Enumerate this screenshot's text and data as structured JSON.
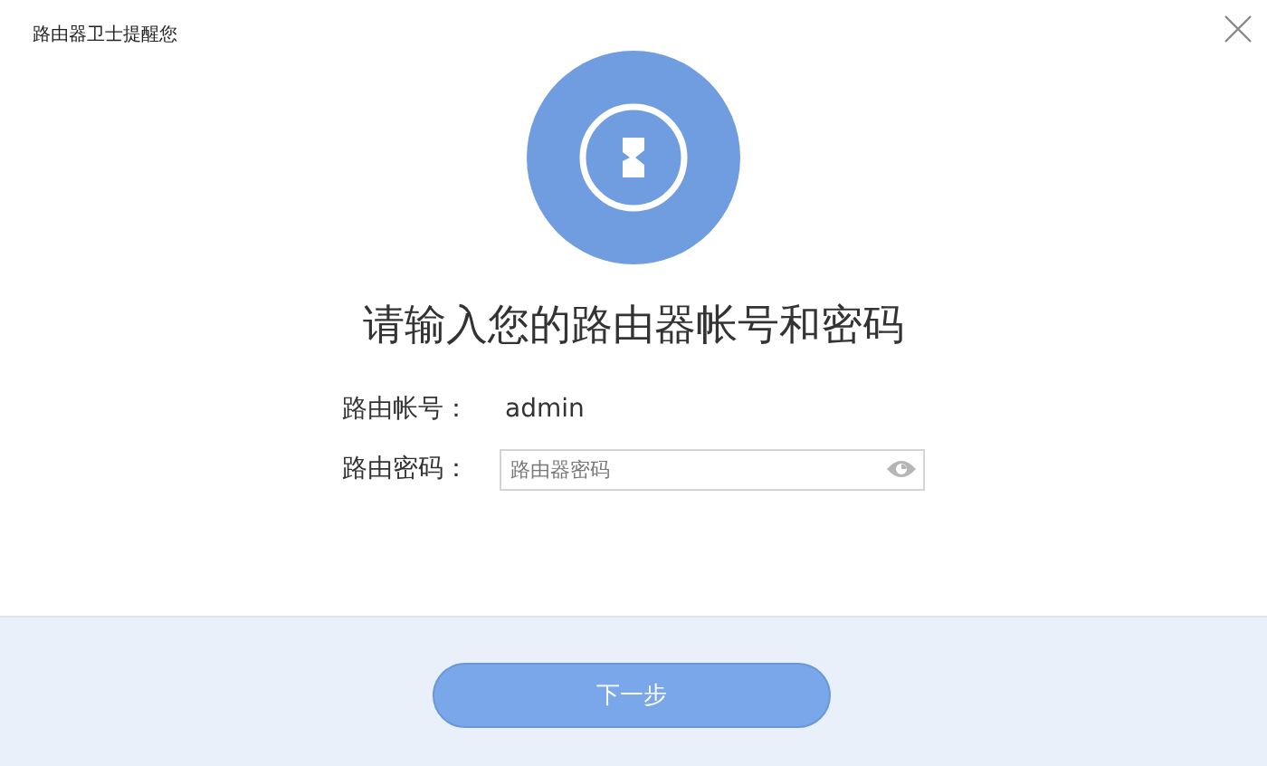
{
  "window": {
    "title": "路由器卫士提醒您"
  },
  "heading": "请输入您的路由器帐号和密码",
  "fields": [
    {
      "kind": "text",
      "label": "路由帐号：",
      "value": "admin"
    },
    {
      "kind": "password",
      "label": "路由密码：",
      "placeholder": "路由器密码"
    }
  ],
  "buttons": [
    {
      "label": "下一步"
    }
  ]
}
